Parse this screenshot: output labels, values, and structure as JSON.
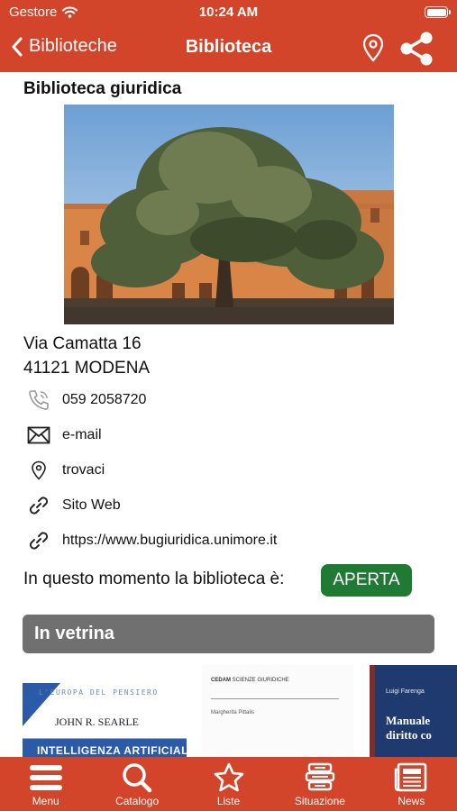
{
  "status_bar": {
    "carrier": "Gestore",
    "time": "10:24 AM"
  },
  "nav": {
    "back_label": "Biblioteche",
    "title": "Biblioteca"
  },
  "library": {
    "name": "Biblioteca giuridica",
    "address_line1": "Via Camatta 16",
    "address_line2": "41121 MODENA",
    "contacts": [
      {
        "icon": "phone-icon",
        "label": "059 2058720"
      },
      {
        "icon": "mail-icon",
        "label": "e-mail"
      },
      {
        "icon": "map-pin-icon",
        "label": "trovaci"
      },
      {
        "icon": "link-icon",
        "label": "Sito Web"
      },
      {
        "icon": "link-icon",
        "label": "https://www.bugiuridica.unimore.it"
      }
    ],
    "status_text": "In questo momento la biblioteca è:",
    "status_badge": "APERTA",
    "status_color": "#1f7a33"
  },
  "vetrina": {
    "title": "In vetrina",
    "books": [
      {
        "series": "L'EUROPA DEL PENSIERO",
        "author": "JOHN R. SEARLE",
        "title": "INTELLIGENZA ARTIFICIALE"
      },
      {
        "publisher": "CEDAM",
        "series": "SCIENZE GIURIDICHE",
        "author": "Margherita Pittalis"
      },
      {
        "author": "Luigi Farenga",
        "title": "Manuale diritto co"
      }
    ]
  },
  "tabbar": {
    "items": [
      {
        "icon": "menu-icon",
        "label": "Menu"
      },
      {
        "icon": "search-icon",
        "label": "Catalogo"
      },
      {
        "icon": "star-icon",
        "label": "Liste"
      },
      {
        "icon": "books-stack-icon",
        "label": "Situazione"
      },
      {
        "icon": "newspaper-icon",
        "label": "News"
      }
    ]
  },
  "colors": {
    "brand": "#d3452a",
    "vetrina_header": "#707070",
    "open_badge": "#1f7a33"
  }
}
